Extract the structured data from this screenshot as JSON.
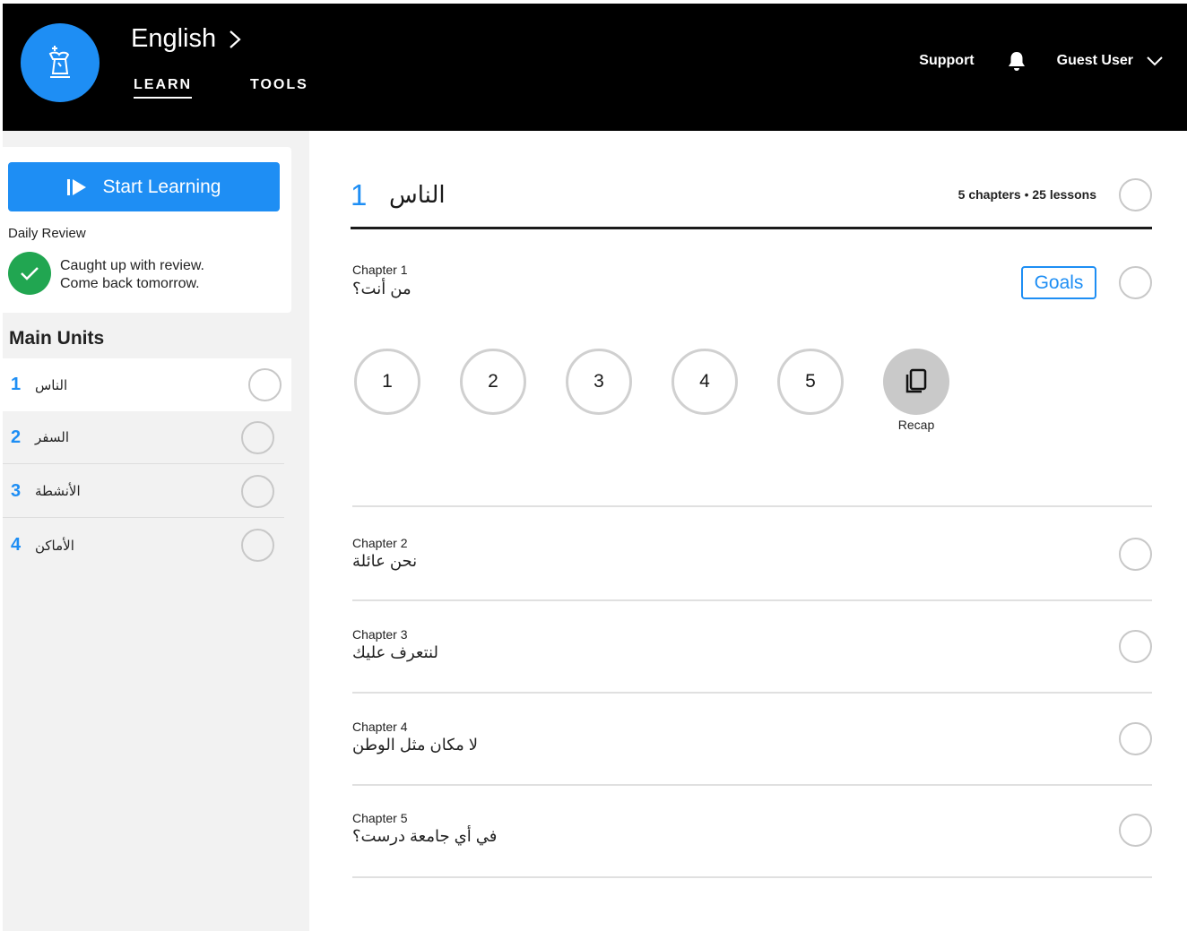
{
  "header": {
    "language": "English",
    "nav": {
      "learn": "LEARN",
      "tools": "TOOLS"
    },
    "support": "Support",
    "user": "Guest User",
    "icons": {
      "logo": "chess-king-icon",
      "bell": "bell-icon",
      "chevron": "chevron-down-icon"
    }
  },
  "sidebar": {
    "start_button": "Start Learning",
    "daily_review_title": "Daily Review",
    "review_line1": "Caught up with review.",
    "review_line2": "Come back tomorrow.",
    "units_title": "Main Units",
    "units": [
      {
        "num": "1",
        "name": "الناس"
      },
      {
        "num": "2",
        "name": "السفر"
      },
      {
        "num": "3",
        "name": "الأنشطة"
      },
      {
        "num": "4",
        "name": "الأماكن"
      }
    ]
  },
  "main": {
    "unit_number": "1",
    "unit_name": "الناس",
    "meta_chapters": "5 chapters",
    "meta_sep": " • ",
    "meta_lessons": "25 lessons",
    "goals_label": "Goals",
    "lessons": [
      "1",
      "2",
      "3",
      "4",
      "5"
    ],
    "recap_label": "Recap",
    "chapters": [
      {
        "label": "Chapter 1",
        "title": "من أنت؟"
      },
      {
        "label": "Chapter 2",
        "title": "نحن عائلة"
      },
      {
        "label": "Chapter 3",
        "title": "لنتعرف عليك"
      },
      {
        "label": "Chapter 4",
        "title": "لا مكان مثل الوطن"
      },
      {
        "label": "Chapter 5",
        "title": "في أي جامعة درست؟"
      }
    ]
  },
  "colors": {
    "accent": "#1e8ef4",
    "success": "#21a651",
    "header_bg": "#000000",
    "sidebar_bg": "#f2f2f2"
  }
}
